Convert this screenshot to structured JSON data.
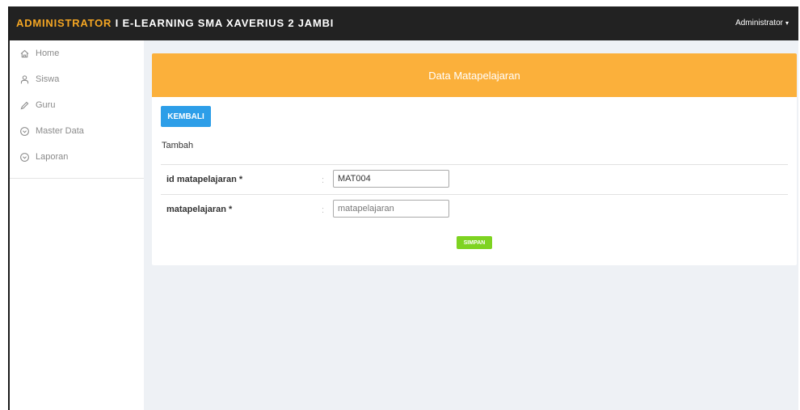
{
  "header": {
    "brand_role": "ADMINISTRATOR",
    "brand_sep": " I ",
    "brand_app": "E-LEARNING SMA XAVERIUS 2 JAMBI",
    "user_label": "Administrator",
    "user_caret": "▾"
  },
  "sidebar": {
    "items": [
      {
        "label": "Home",
        "icon": "home-icon"
      },
      {
        "label": "Siswa",
        "icon": "user-icon"
      },
      {
        "label": "Guru",
        "icon": "pencil-icon"
      },
      {
        "label": "Master Data",
        "icon": "chevron-circle-down-icon"
      },
      {
        "label": "Laporan",
        "icon": "chevron-circle-down-icon"
      }
    ]
  },
  "panel": {
    "title": "Data Matapelajaran",
    "back_label": "KEMBALI",
    "subtitle": "Tambah",
    "fields": [
      {
        "label": "id matapelajaran *",
        "colon": ":",
        "value": "MAT004",
        "placeholder": ""
      },
      {
        "label": "matapelajaran *",
        "colon": ":",
        "value": "",
        "placeholder": "matapelajaran"
      }
    ],
    "save_label": "SIMPAN"
  },
  "colors": {
    "topbar": "#222222",
    "brand_role": "#f5a623",
    "panel_header": "#fbb03b",
    "back_button": "#2d9ee8",
    "save_button": "#7ed321",
    "background": "#eef1f5"
  }
}
